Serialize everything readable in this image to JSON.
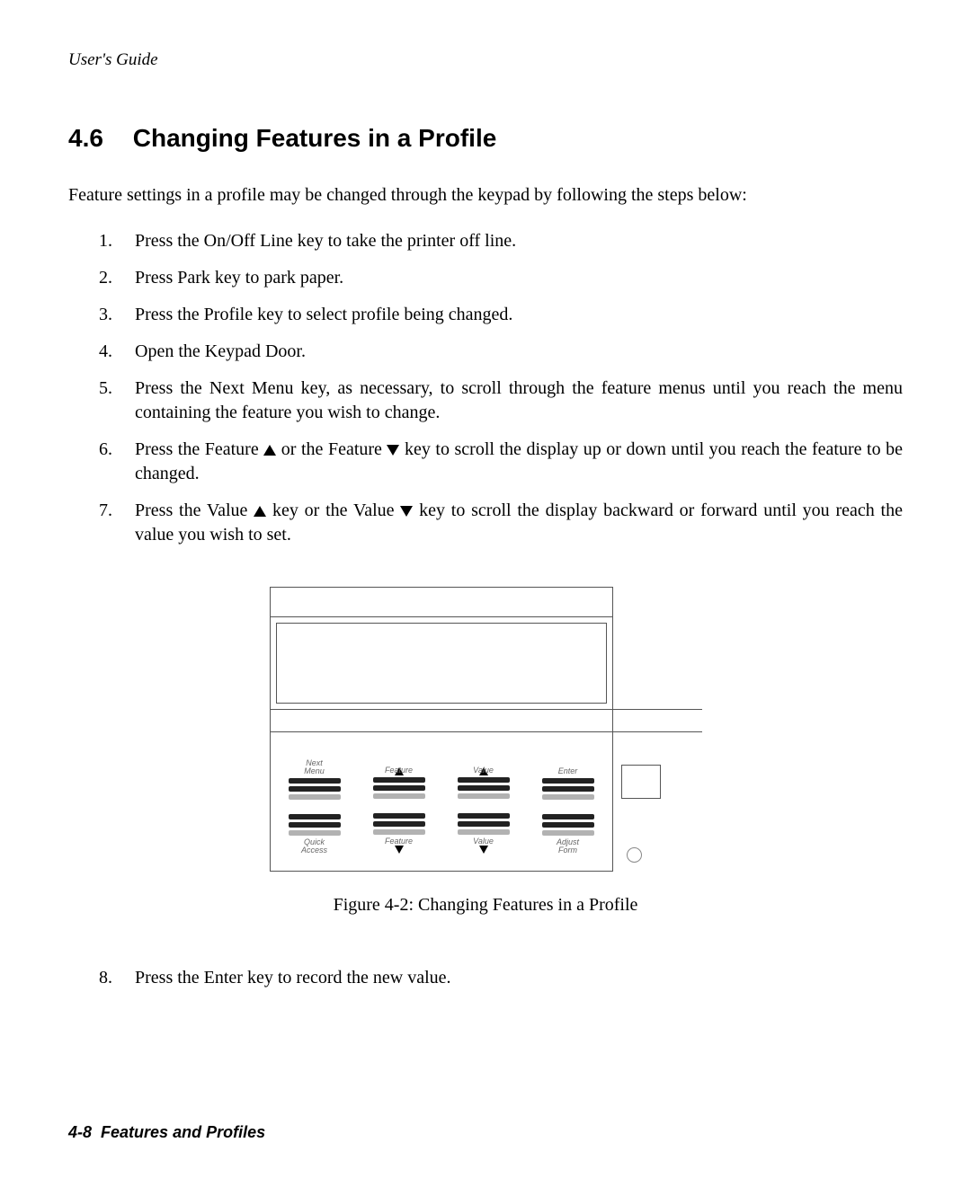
{
  "header": {
    "running": "User's Guide"
  },
  "section": {
    "number": "4.6",
    "title": "Changing Features in a Profile"
  },
  "intro": "Feature settings in a profile may be changed through the keypad by following the steps below:",
  "steps": [
    {
      "n": "1.",
      "text": "Press the On/Off Line key to take the printer off line."
    },
    {
      "n": "2.",
      "text": "Press Park key to park paper."
    },
    {
      "n": "3.",
      "text": "Press the Profile key to select profile being changed."
    },
    {
      "n": "4.",
      "text": "Open the Keypad Door."
    },
    {
      "n": "5.",
      "text": "Press the Next Menu key, as necessary, to scroll through the feature menus until you reach the menu containing the feature you wish to change."
    },
    {
      "n": "6.",
      "pre": "Press the Feature ",
      "mid": " or the Feature ",
      "post": " key to scroll the display up or down until you reach the feature to be changed."
    },
    {
      "n": "7.",
      "pre": "Press the Value ",
      "mid": " key or the Value ",
      "post": " key to scroll the display backward or forward until you reach the value you wish to set."
    }
  ],
  "figure": {
    "caption": "Figure 4-2:  Changing Features in a Profile",
    "keys_top": [
      "Next Menu",
      "Feature",
      "Value",
      "Enter"
    ],
    "keys_bottom": [
      "Quick Access",
      "Feature",
      "Value",
      "Adjust Form"
    ]
  },
  "steps_after": [
    {
      "n": "8.",
      "text": "Press the Enter key to record the new value."
    }
  ],
  "footer": {
    "page": "4-8",
    "section": "Features and Profiles"
  }
}
